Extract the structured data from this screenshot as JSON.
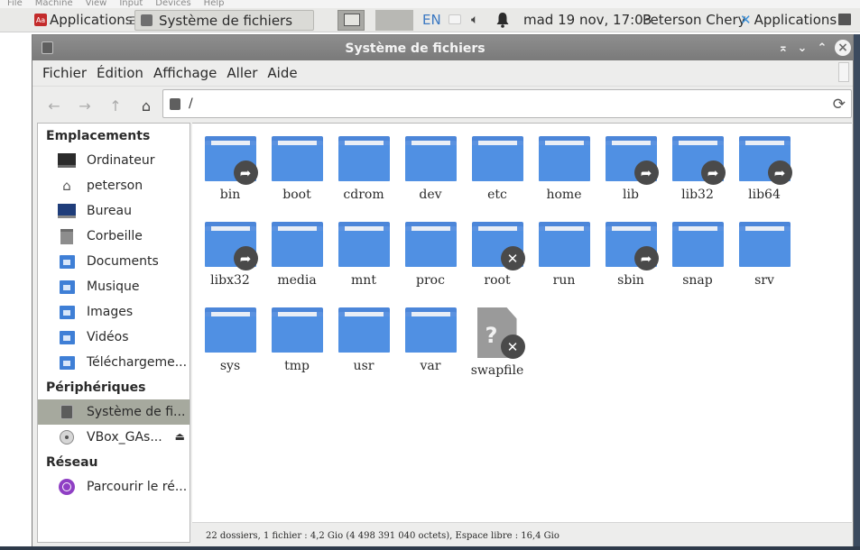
{
  "host_menu": [
    "File",
    "Machine",
    "View",
    "Input",
    "Devices",
    "Help"
  ],
  "panel": {
    "apps_label": "Applications",
    "apps_icon_text": "Aa",
    "task_label": "Système de fichiers",
    "lang": "EN",
    "clock": "mad 19 nov, 17:03",
    "user": "Peterson Chery",
    "apps2_label": "Applications"
  },
  "window": {
    "title": "Système de fichiers",
    "menus": [
      "Fichier",
      "Édition",
      "Affichage",
      "Aller",
      "Aide"
    ],
    "path": "/"
  },
  "sidebar": {
    "places_heading": "Emplacements",
    "places": [
      {
        "label": "Ordinateur",
        "icon": "computer-icon"
      },
      {
        "label": "peterson",
        "icon": "home-icon"
      },
      {
        "label": "Bureau",
        "icon": "desktop-icon"
      },
      {
        "label": "Corbeille",
        "icon": "trash-icon"
      },
      {
        "label": "Documents",
        "icon": "documents-folder-icon"
      },
      {
        "label": "Musique",
        "icon": "music-folder-icon"
      },
      {
        "label": "Images",
        "icon": "pictures-folder-icon"
      },
      {
        "label": "Vidéos",
        "icon": "videos-folder-icon"
      },
      {
        "label": "Téléchargeme...",
        "icon": "downloads-folder-icon"
      }
    ],
    "devices_heading": "Périphériques",
    "devices": [
      {
        "label": "Système de fi...",
        "icon": "drive-icon",
        "selected": true
      },
      {
        "label": "VBox_GAs...",
        "icon": "optical-disc-icon",
        "eject": true
      }
    ],
    "network_heading": "Réseau",
    "network": [
      {
        "label": "Parcourir le ré...",
        "icon": "network-icon"
      }
    ]
  },
  "items": [
    {
      "name": "bin",
      "type": "folder",
      "badge": "link"
    },
    {
      "name": "boot",
      "type": "folder",
      "badge": ""
    },
    {
      "name": "cdrom",
      "type": "folder",
      "badge": ""
    },
    {
      "name": "dev",
      "type": "folder",
      "badge": ""
    },
    {
      "name": "etc",
      "type": "folder",
      "badge": ""
    },
    {
      "name": "home",
      "type": "folder",
      "badge": ""
    },
    {
      "name": "lib",
      "type": "folder",
      "badge": "link"
    },
    {
      "name": "lib32",
      "type": "folder",
      "badge": "link"
    },
    {
      "name": "lib64",
      "type": "folder",
      "badge": "link"
    },
    {
      "name": "libx32",
      "type": "folder",
      "badge": "link"
    },
    {
      "name": "media",
      "type": "folder",
      "badge": ""
    },
    {
      "name": "mnt",
      "type": "folder",
      "badge": ""
    },
    {
      "name": "proc",
      "type": "folder",
      "badge": ""
    },
    {
      "name": "root",
      "type": "folder",
      "badge": "locked"
    },
    {
      "name": "run",
      "type": "folder",
      "badge": ""
    },
    {
      "name": "sbin",
      "type": "folder",
      "badge": "link"
    },
    {
      "name": "snap",
      "type": "folder",
      "badge": ""
    },
    {
      "name": "srv",
      "type": "folder",
      "badge": ""
    },
    {
      "name": "sys",
      "type": "folder",
      "badge": ""
    },
    {
      "name": "tmp",
      "type": "folder",
      "badge": ""
    },
    {
      "name": "usr",
      "type": "folder",
      "badge": ""
    },
    {
      "name": "var",
      "type": "folder",
      "badge": ""
    },
    {
      "name": "swapfile",
      "type": "file",
      "badge": "locked"
    }
  ],
  "status": "22 dossiers, 1 fichier : 4,2 Gio (4 498 391 040 octets), Espace libre : 16,4 Gio",
  "colors": {
    "folder": "#5b92e0",
    "selection": "#a6a99e",
    "titlebar": "#858585",
    "lang": "#3a78c2"
  }
}
